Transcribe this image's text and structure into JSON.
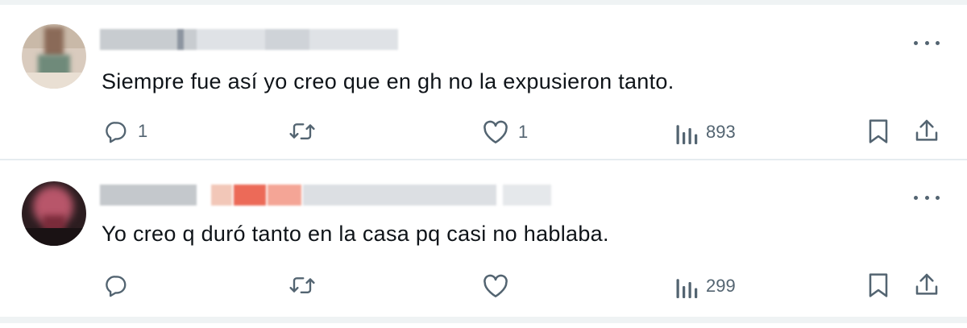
{
  "tweets": [
    {
      "text": "Siempre fue así yo creo que en gh no la expusieron tanto.",
      "replies": "1",
      "likes": "1",
      "views": "893"
    },
    {
      "text": "Yo creo q duró tanto en la casa pq casi no hablaba.",
      "replies": "",
      "likes": "",
      "views": "299"
    }
  ],
  "icons": {
    "reply": "reply-icon",
    "retweet": "retweet-icon",
    "like": "like-icon",
    "views": "views-icon",
    "bookmark": "bookmark-icon",
    "share": "share-icon",
    "more": "more-icon"
  },
  "colors": {
    "text": "#0f1419",
    "muted": "#536471",
    "divider": "#e6ecf0"
  }
}
